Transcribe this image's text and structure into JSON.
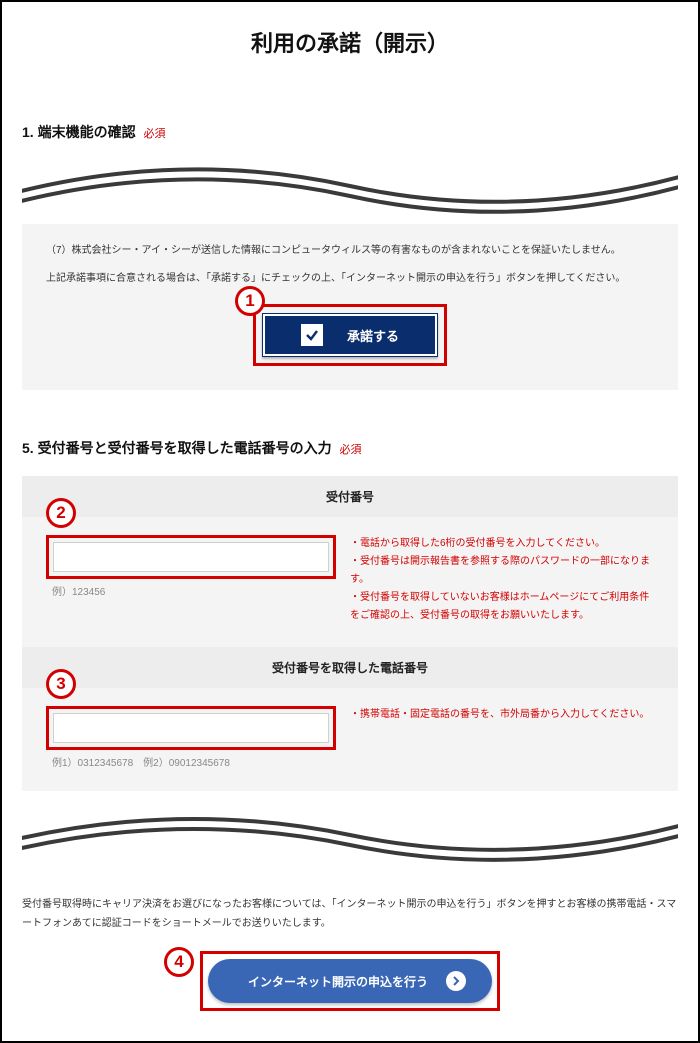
{
  "page_title": "利用の承諾（開示）",
  "section1": {
    "heading": "1. 端末機能の確認",
    "required_label": "必須"
  },
  "consent_panel": {
    "line7": "（7）株式会社シー・アイ・シーが送信した情報にコンピュータウィルス等の有害なものが含まれないことを保証いたしません。",
    "agree_note": "上記承諾事項に合意される場合は、「承諾する」にチェックの上、「インターネット開示の申込を行う」ボタンを押してください。",
    "accept_label": "承諾する"
  },
  "section5": {
    "heading": "5. 受付番号と受付番号を取得した電話番号の入力",
    "required_label": "必須",
    "subheader_receipt": "受付番号",
    "receipt_placeholder": " ",
    "receipt_example": "例）123456",
    "receipt_hints": [
      "・電話から取得した6桁の受付番号を入力してください。",
      "・受付番号は開示報告書を参照する際のパスワードの一部になります。",
      "・受付番号を取得していないお客様はホームページにてご利用条件をご確認の上、受付番号の取得をお願いいたします。"
    ],
    "subheader_phone": "受付番号を取得した電話番号",
    "phone_placeholder": " ",
    "phone_example": "例1）0312345678　例2）09012345678",
    "phone_hint": "・携帯電話・固定電話の番号を、市外局番から入力してください。"
  },
  "bottom_note": "受付番号取得時にキャリア決済をお選びになったお客様については、「インターネット開示の申込を行う」ボタンを押すとお客様の携帯電話・スマートフォンあてに認証コードをショートメールでお送りいたします。",
  "submit_label": "インターネット開示の申込を行う",
  "callouts": {
    "c1": "1",
    "c2": "2",
    "c3": "3",
    "c4": "4"
  }
}
